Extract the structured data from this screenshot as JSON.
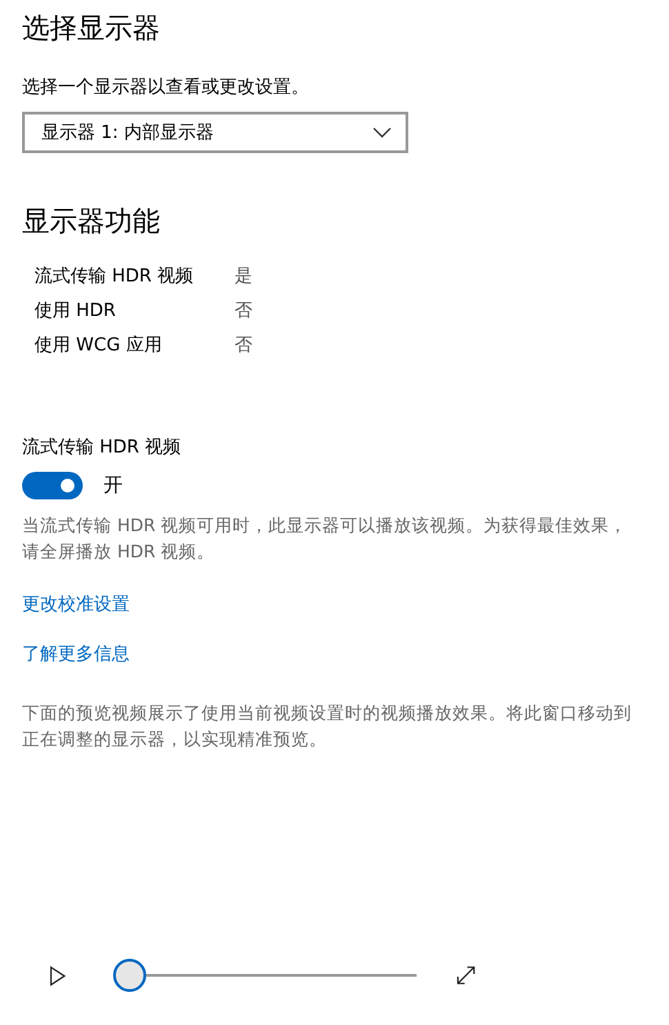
{
  "title": "选择显示器",
  "select_prompt": "选择一个显示器以查看或更改设置。",
  "display_dropdown": {
    "value": "显示器 1: 内部显示器"
  },
  "capabilities": {
    "heading": "显示器功能",
    "rows": [
      {
        "label": "流式传输 HDR 视频",
        "value": "是"
      },
      {
        "label": "使用 HDR",
        "value": "否"
      },
      {
        "label": "使用 WCG 应用",
        "value": "否"
      }
    ]
  },
  "hdr_streaming": {
    "label": "流式传输 HDR 视频",
    "on": true,
    "state_text": "开",
    "description": "当流式传输 HDR 视频可用时，此显示器可以播放该视频。为获得最佳效果，请全屏播放 HDR 视频。"
  },
  "links": [
    "更改校准设置",
    "了解更多信息"
  ],
  "preview_note": "下面的预览视频展示了使用当前视频设置时的视频播放效果。将此窗口移动到正在调整的显示器，以实现精准预览。",
  "player": {
    "level": 0
  }
}
